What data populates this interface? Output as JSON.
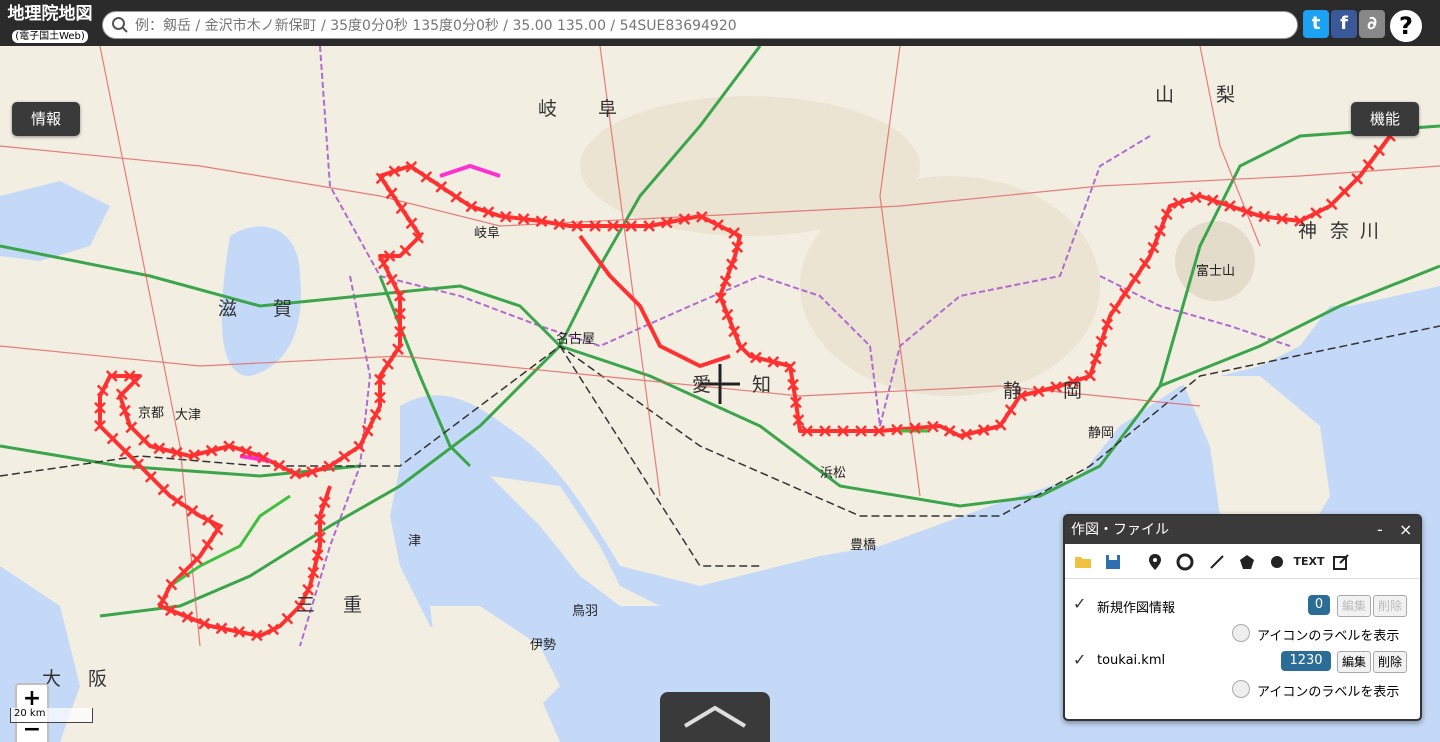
{
  "header": {
    "title": "地理院地図",
    "subtitle": "(電子国土Web)",
    "search_placeholder": "例：剱岳 / 金沢市木ノ新保町 / 35度0分0秒 135度0分0秒 / 35.00 135.00 / 54SUE83694920",
    "twitter_icon": "twitter-icon",
    "facebook_icon": "facebook-icon",
    "link_icon": "paperclip-icon",
    "help_label": "?"
  },
  "buttons": {
    "info": "情報",
    "functions": "機能",
    "zoom_in": "+",
    "zoom_out": "−"
  },
  "scale": "20 km",
  "map_labels": {
    "prefectures": [
      "岐",
      "阜",
      "山",
      "梨",
      "滋",
      "賀",
      "愛",
      "知",
      "静",
      "岡",
      "神",
      "奈",
      "川",
      "三",
      "重",
      "大",
      "阪"
    ],
    "places": [
      "名古屋",
      "京都",
      "大津",
      "富士山",
      "津",
      "浜松",
      "静岡",
      "鳥羽",
      "伊勢",
      "岐阜",
      "豊橋"
    ]
  },
  "panel": {
    "title": "作図・ファイル",
    "minimize": "-",
    "close": "×",
    "tool_text": "TEXT",
    "rows": [
      {
        "label": "新規作図情報",
        "count": "0",
        "edit": "編集",
        "delete": "削除",
        "checked": true,
        "enabled": false
      },
      {
        "label": "toukai.kml",
        "count": "1230",
        "edit": "編集",
        "delete": "削除",
        "checked": true,
        "enabled": true
      }
    ],
    "icon_label_option": "アイコンのラベルを表示"
  },
  "colors": {
    "track": "#ff3030",
    "highway": "#2e9e3e",
    "sea": "#c4d9f7",
    "header_bg": "#2b2b2b"
  }
}
